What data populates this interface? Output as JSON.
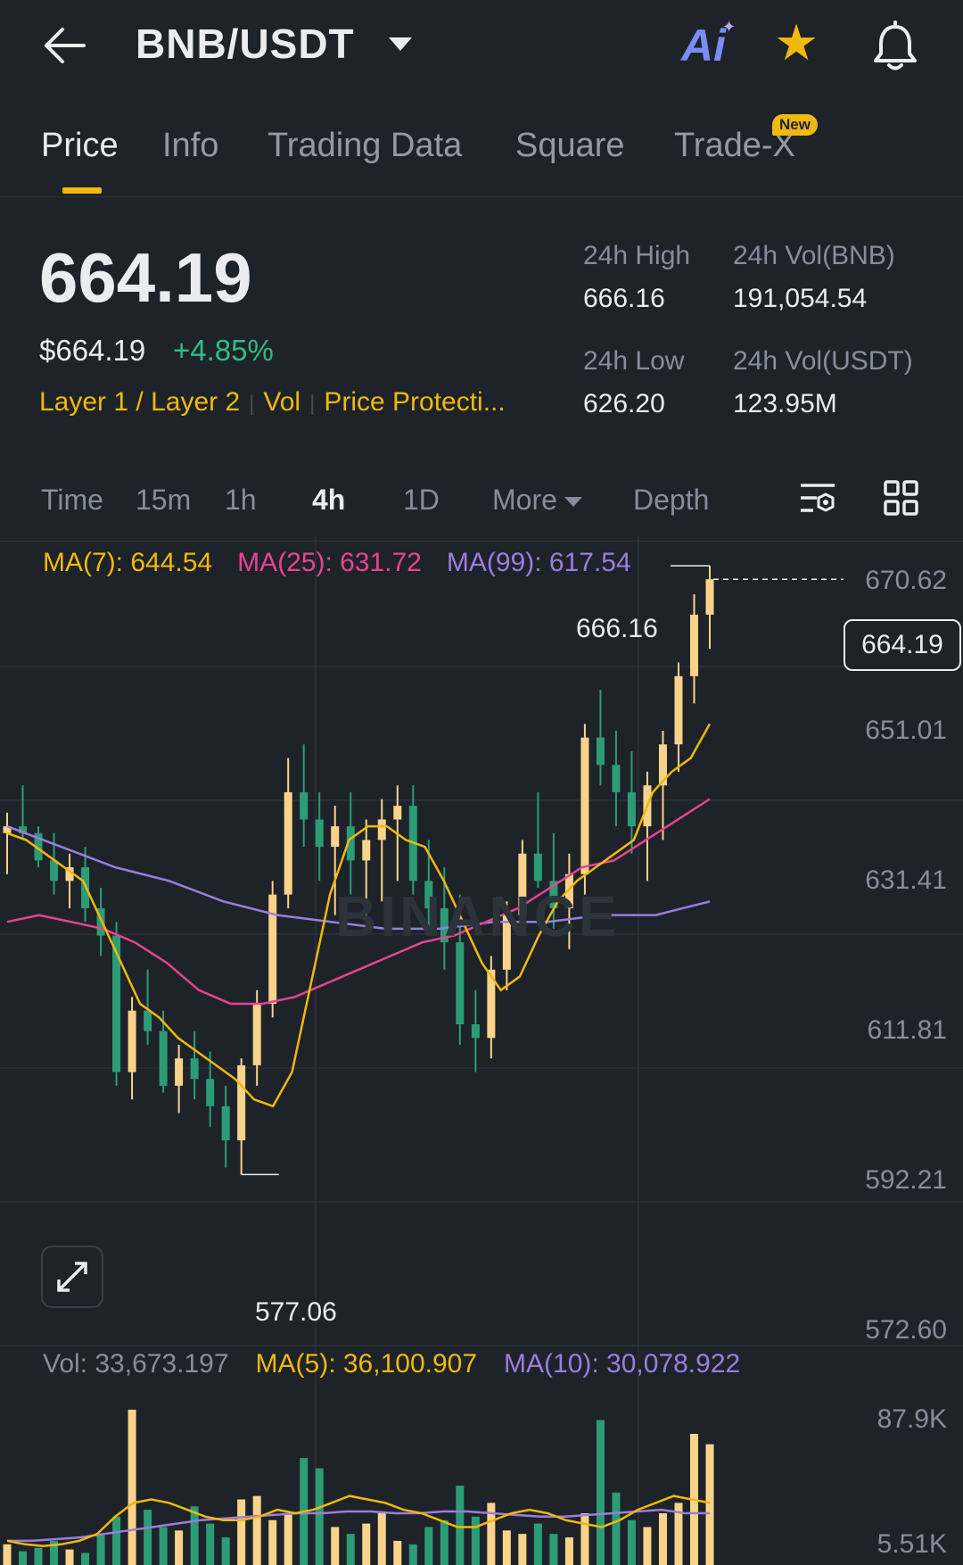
{
  "header": {
    "pair": "BNB/USDT",
    "ai_label": "Ai",
    "colors": {
      "accent": "#f0b90b",
      "up": "#2ebd85",
      "down": "#f6465d",
      "bg": "#1e2329"
    }
  },
  "tabs": [
    {
      "label": "Price",
      "active": true
    },
    {
      "label": "Info"
    },
    {
      "label": "Trading Data"
    },
    {
      "label": "Square"
    },
    {
      "label": "Trade-X",
      "badge": "New"
    }
  ],
  "price": {
    "last": "664.19",
    "usd": "$664.19",
    "change": "+4.85%",
    "tags": [
      "Layer 1 / Layer 2",
      "Vol",
      "Price Protecti..."
    ]
  },
  "stats": {
    "high_label": "24h High",
    "high_value": "666.16",
    "low_label": "24h Low",
    "low_value": "626.20",
    "vol_bnb_label": "24h Vol(BNB)",
    "vol_bnb_value": "191,054.54",
    "vol_usdt_label": "24h Vol(USDT)",
    "vol_usdt_value": "123.95M"
  },
  "intervals": {
    "items": [
      "Time",
      "15m",
      "1h",
      "4h",
      "1D",
      "More",
      "Depth"
    ],
    "active": "4h"
  },
  "chart": {
    "ma7": "MA(7): 644.54",
    "ma25": "MA(25): 631.72",
    "ma99": "MA(99): 617.54",
    "y_labels": [
      "670.62",
      "651.01",
      "631.41",
      "611.81",
      "592.21",
      "572.60"
    ],
    "high_marker": "666.16",
    "low_marker": "577.06",
    "current_price": "664.19",
    "watermark": "BINANCE"
  },
  "volume": {
    "vol": "Vol: 33,673.197",
    "ma5": "MA(5): 36,100.907",
    "ma10": "MA(10): 30,078.922",
    "y_labels": [
      "87.9K",
      "5.51K"
    ]
  },
  "chart_data": {
    "type": "candlestick",
    "interval": "4h",
    "ylim": [
      572.6,
      670.62
    ],
    "y_ticks": [
      670.62,
      651.01,
      631.41,
      611.81,
      592.21,
      572.6
    ],
    "ohlc": [
      [
        627,
        630,
        621,
        628
      ],
      [
        628,
        634,
        626,
        627
      ],
      [
        627,
        628,
        622,
        623
      ],
      [
        623,
        627,
        618,
        620
      ],
      [
        620,
        624,
        616,
        622
      ],
      [
        622,
        625,
        614,
        616
      ],
      [
        616,
        619,
        609,
        612
      ],
      [
        612,
        614,
        590,
        592
      ],
      [
        592,
        603,
        588,
        601
      ],
      [
        601,
        607,
        596,
        598
      ],
      [
        598,
        601,
        589,
        590
      ],
      [
        590,
        596,
        586,
        594
      ],
      [
        594,
        598,
        588,
        591
      ],
      [
        591,
        595,
        584,
        587
      ],
      [
        587,
        590,
        578,
        582
      ],
      [
        582,
        594,
        577,
        593
      ],
      [
        593,
        604,
        590,
        602
      ],
      [
        602,
        620,
        600,
        618
      ],
      [
        618,
        638,
        616,
        633
      ],
      [
        633,
        640,
        625,
        629
      ],
      [
        629,
        633,
        620,
        625
      ],
      [
        625,
        631,
        615,
        628
      ],
      [
        628,
        633,
        618,
        623
      ],
      [
        623,
        629,
        615,
        626
      ],
      [
        626,
        632,
        617,
        629
      ],
      [
        629,
        634,
        620,
        631
      ],
      [
        631,
        634,
        618,
        620
      ],
      [
        620,
        626,
        612,
        616
      ],
      [
        616,
        622,
        607,
        611
      ],
      [
        611,
        618,
        596,
        599
      ],
      [
        599,
        604,
        592,
        597
      ],
      [
        597,
        609,
        594,
        607
      ],
      [
        607,
        617,
        604,
        615
      ],
      [
        615,
        626,
        612,
        624
      ],
      [
        624,
        633,
        619,
        620
      ],
      [
        620,
        627,
        613,
        616
      ],
      [
        616,
        624,
        610,
        621
      ],
      [
        621,
        643,
        618,
        641
      ],
      [
        641,
        648,
        634,
        637
      ],
      [
        637,
        642,
        628,
        633
      ],
      [
        633,
        639,
        624,
        628
      ],
      [
        628,
        636,
        620,
        634
      ],
      [
        634,
        642,
        626,
        640
      ],
      [
        640,
        652,
        636,
        650
      ],
      [
        650,
        662,
        646,
        659
      ],
      [
        659,
        666.16,
        654,
        664.19
      ]
    ],
    "ma7": [
      627,
      626,
      624,
      622,
      620,
      614,
      608,
      602,
      600,
      597,
      595,
      593,
      591,
      588,
      587,
      592,
      605,
      618,
      626,
      628,
      628,
      626,
      625,
      620,
      614,
      608,
      604,
      606,
      612,
      617,
      620,
      622,
      624,
      626,
      633,
      636,
      638,
      643
    ],
    "ma25": [
      614,
      615,
      614,
      613,
      611,
      608,
      604,
      602,
      602,
      603,
      605,
      607,
      609,
      611,
      612,
      614,
      616,
      619,
      622,
      623,
      626,
      629,
      632
    ],
    "ma99": [
      628,
      625,
      622,
      620,
      617,
      615,
      614,
      613,
      613,
      614,
      614,
      615,
      615,
      617
    ],
    "volume": {
      "ylim": [
        5.51,
        87.9
      ],
      "unit": "K",
      "values": [
        12,
        8,
        10,
        14,
        9,
        7,
        18,
        28,
        90,
        32,
        22,
        20,
        34,
        24,
        16,
        38,
        40,
        26,
        30,
        62,
        56,
        22,
        18,
        24,
        30,
        14,
        12,
        22,
        26,
        46,
        28,
        36,
        20,
        18,
        24,
        18,
        16,
        30,
        84,
        42,
        26,
        22,
        30,
        36,
        76,
        70
      ],
      "ma5": [
        14,
        12,
        11,
        12,
        14,
        18,
        28,
        36,
        38,
        36,
        32,
        28,
        26,
        26,
        28,
        32,
        30,
        32,
        36,
        40,
        38,
        36,
        32,
        30,
        26,
        22,
        22,
        26,
        30,
        32,
        30,
        26,
        24,
        22,
        26,
        32,
        36,
        40,
        38,
        36
      ],
      "ma10": [
        14,
        14,
        15,
        16,
        18,
        20,
        22,
        24,
        26,
        27,
        28,
        29,
        30,
        30,
        31,
        31,
        30,
        30,
        31,
        31,
        30,
        29,
        28,
        28,
        29,
        30,
        31,
        32,
        30,
        30
      ]
    }
  }
}
